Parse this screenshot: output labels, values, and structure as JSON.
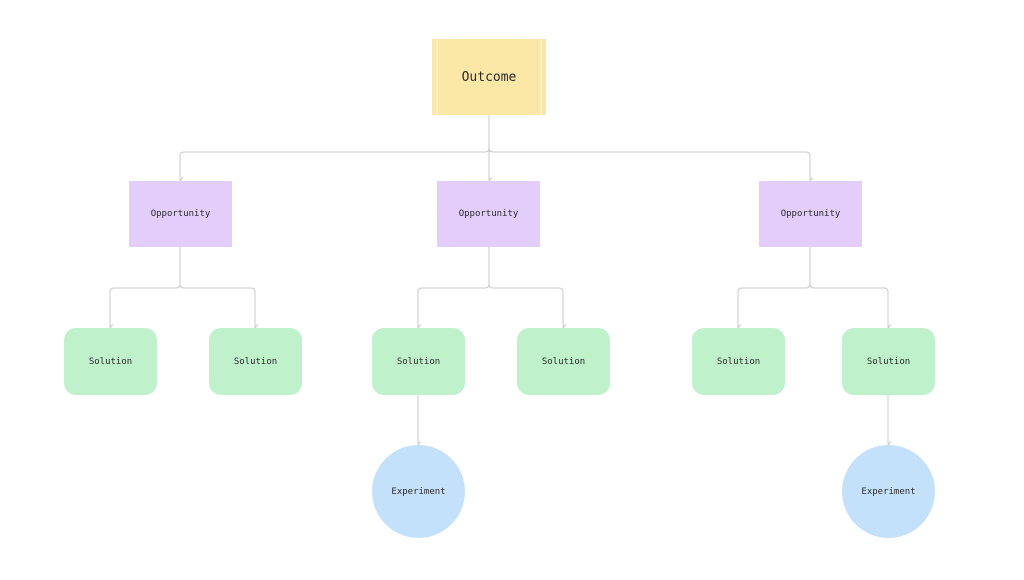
{
  "diagram": {
    "type": "opportunity-solution-tree",
    "colors": {
      "outcome": "#fbe8a6",
      "opportunity": "#e2cdfb",
      "solution": "#bff1cb",
      "experiment": "#c4e1fb",
      "connector": "#c8c8c8"
    },
    "outcome": {
      "label": "Outcome"
    },
    "opportunities": [
      {
        "label": "Opportunity"
      },
      {
        "label": "Opportunity"
      },
      {
        "label": "Opportunity"
      }
    ],
    "solutions": [
      {
        "label": "Solution",
        "parent": 0
      },
      {
        "label": "Solution",
        "parent": 0
      },
      {
        "label": "Solution",
        "parent": 1
      },
      {
        "label": "Solution",
        "parent": 1
      },
      {
        "label": "Solution",
        "parent": 2
      },
      {
        "label": "Solution",
        "parent": 2
      }
    ],
    "experiments": [
      {
        "label": "Experiment",
        "parent_solution": 2
      },
      {
        "label": "Experiment",
        "parent_solution": 5
      }
    ]
  }
}
